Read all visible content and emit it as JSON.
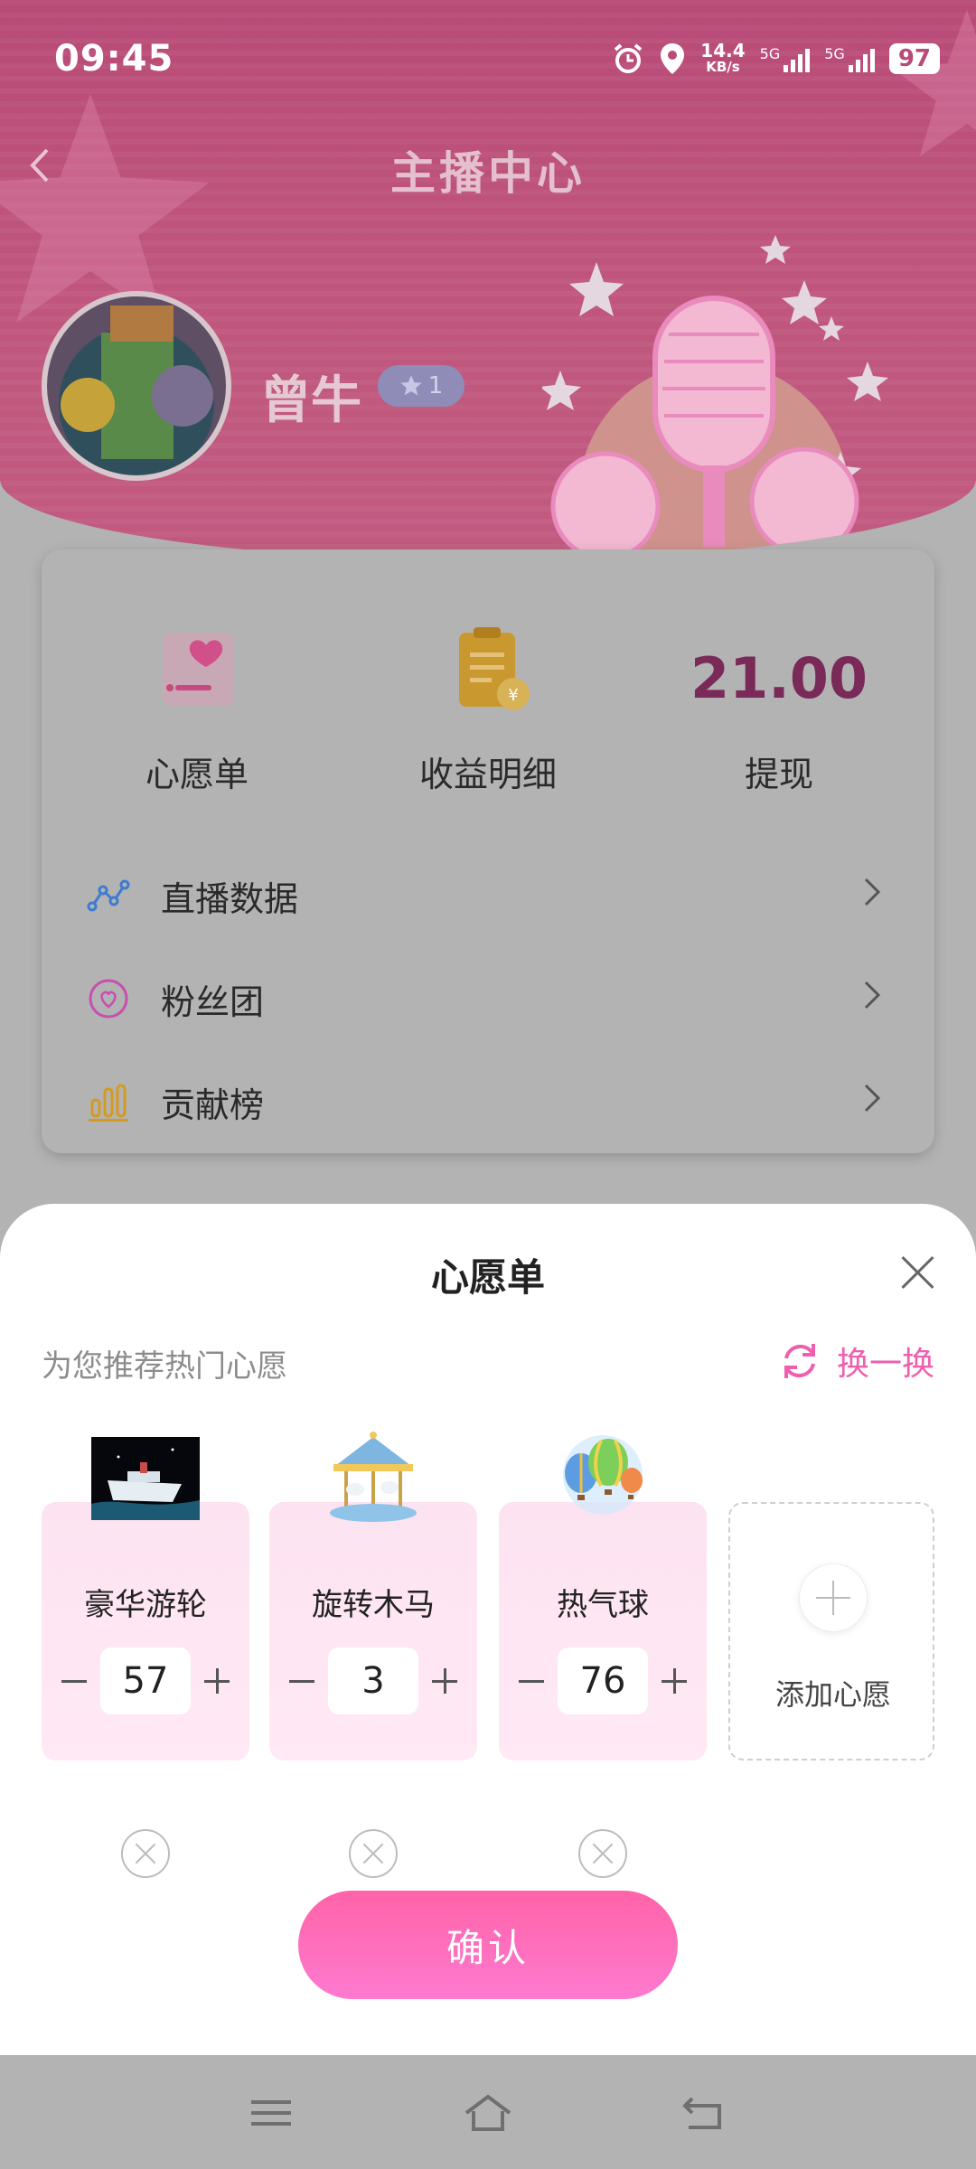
{
  "status_bar": {
    "time": "09:45",
    "speed_value": "14.4",
    "speed_unit": "KB/s",
    "sim1": "5G",
    "sim2": "5G",
    "battery": "97"
  },
  "header": {
    "title": "主播中心",
    "username": "曾牛",
    "level": "1"
  },
  "stats": {
    "wishlist_label": "心愿单",
    "income_label": "收益明细",
    "withdraw_amount": "21.00",
    "withdraw_label": "提现"
  },
  "menu": [
    {
      "label": "直播数据",
      "icon": "line-chart-icon",
      "color": "#3f7bd0"
    },
    {
      "label": "粉丝团",
      "icon": "heart-circle-icon",
      "color": "#c64fb0"
    },
    {
      "label": "贡献榜",
      "icon": "bar-chart-icon",
      "color": "#d49a22"
    }
  ],
  "sheet": {
    "title": "心愿单",
    "recommend_text": "为您推荐热门心愿",
    "refresh_label": "换一换",
    "gifts": [
      {
        "name": "豪华游轮",
        "qty": "57",
        "icon": "cruise-ship-image"
      },
      {
        "name": "旋转木马",
        "qty": "3",
        "icon": "carousel-image"
      },
      {
        "name": "热气球",
        "qty": "76",
        "icon": "hot-air-balloon-image"
      }
    ],
    "add_label": "添加心愿",
    "confirm_label": "确认"
  },
  "colors": {
    "accent": "#ff63a8",
    "refresh": "#ee5fb0",
    "money": "#7a2a58"
  }
}
